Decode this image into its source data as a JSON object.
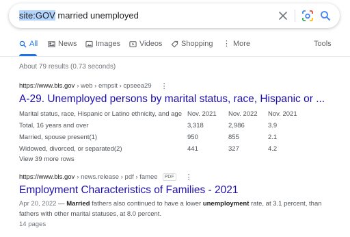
{
  "search": {
    "query_operator": "site:GOV",
    "query_rest": " married unemployed"
  },
  "tabs": [
    {
      "label": "All",
      "icon": "search-icon",
      "active": true
    },
    {
      "label": "News",
      "icon": "news-icon"
    },
    {
      "label": "Images",
      "icon": "images-icon"
    },
    {
      "label": "Videos",
      "icon": "videos-icon"
    },
    {
      "label": "Shopping",
      "icon": "shopping-tag-icon"
    },
    {
      "label": "More",
      "icon": "more-dots-icon"
    }
  ],
  "tools_label": "Tools",
  "stats": "About 79 results (0.73 seconds)",
  "results": [
    {
      "domain": "https://www.bls.gov",
      "path": " › web › empsit › cpseea29",
      "title": "A-29. Unemployed persons by marital status, race, Hispanic or ...",
      "table": {
        "header": [
          "Marital status, race, Hispanic or Latino ethnicity, and age",
          "Nov. 2021",
          "Nov. 2022",
          "Nov. 2021"
        ],
        "rows": [
          [
            "Total, 16 years and over",
            "3,318",
            "2,986",
            "3.9"
          ],
          [
            "Married, spouse present(1)",
            "950",
            "855",
            "2.1"
          ],
          [
            "Widowed, divorced, or separated(2)",
            "441",
            "327",
            "4.2"
          ]
        ]
      },
      "more": "View 39 more rows"
    },
    {
      "domain": "https://www.bls.gov",
      "path": " › news.release › pdf › famee",
      "badge": "PDF",
      "title": "Employment Characteristics of Families - 2021",
      "snippet": {
        "date": "Apr 20, 2022",
        "sep": " — ",
        "b1": "Married",
        "t1": " fathers also continued to have a lower ",
        "b2": "unemployment",
        "t2": " rate, at 3.1 percent, than fathers with other marital statuses, at 8.0 percent."
      },
      "pages": "14 pages"
    }
  ],
  "colors": {
    "link": "#1a0dab",
    "accent": "#1a73e8",
    "text_secondary": "#4d5156",
    "query_highlight": "#b3d4fc"
  }
}
